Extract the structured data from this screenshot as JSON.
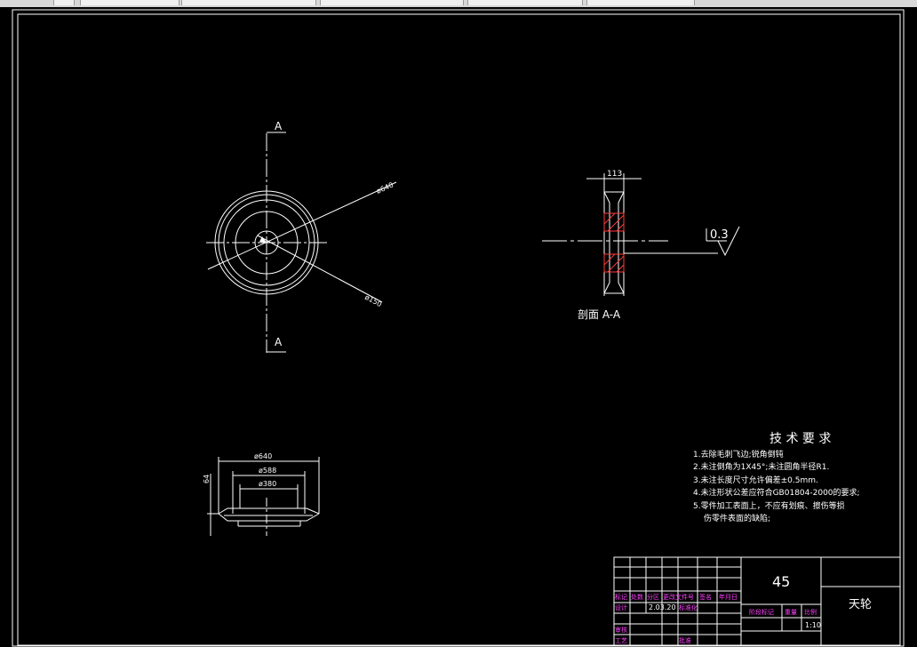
{
  "colors": {
    "background": "#000000",
    "line": "#ffffff",
    "hatch": "#ff3b3b",
    "table_label": "#ff40ff"
  },
  "toolbar": {
    "tabs": [
      "",
      "",
      "",
      "",
      "",
      ""
    ]
  },
  "drawing": {
    "section_marker_top": "A",
    "section_marker_bottom": "A",
    "dim_outer": "ø640",
    "dim_hub": "ø150",
    "section_width": "113",
    "section_title": "剖面 A-A",
    "runout": "0.3",
    "bottom_outer": "ø640",
    "bottom_middle": "ø588",
    "bottom_inner": "ø380",
    "bottom_height": "64"
  },
  "tech_requirements": {
    "title": "技 术 要 求",
    "items": [
      "1.去除毛刺飞边;锐角倒钝",
      "2.未注倒角为1X45°;未注圆角半径R1.",
      "3.未注长度尺寸允许偏差±0.5mm.",
      "4.未注形状公差应符合GB01804-2000的要求;",
      "5.零件加工表面上，不应有划痕、擦伤等损",
      "伤零件表面的缺陷;"
    ]
  },
  "title_block": {
    "material": "45",
    "part_name": "天轮",
    "scale": "1:10",
    "date": "2.03.20",
    "labels": {
      "marker": "标记",
      "count": "处数",
      "zone": "分区",
      "change_doc": "更改文件号",
      "signature": "签名",
      "ymd": "年月日",
      "designer": "设计",
      "standardize": "标准化",
      "stage_mark": "阶段标记",
      "weight": "重量",
      "scale_label": "比例",
      "review": "审核",
      "process": "工艺",
      "approve": "批准"
    }
  }
}
